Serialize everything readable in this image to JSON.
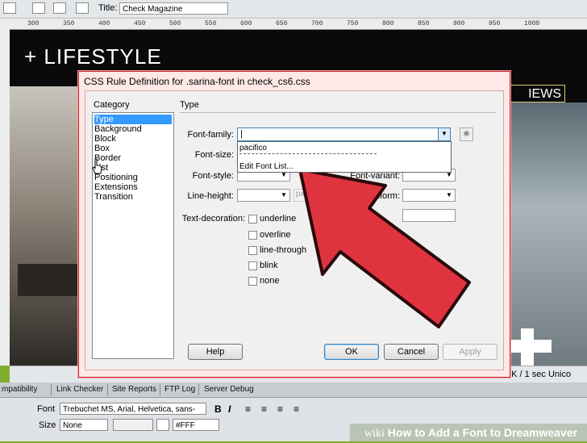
{
  "toolbar": {
    "title_label": "Title:",
    "title_value": "Check Magazine"
  },
  "ruler": {
    "ticks": [
      "300",
      "350",
      "400",
      "450",
      "500",
      "550",
      "600",
      "650",
      "700",
      "750",
      "800",
      "850",
      "900",
      "950",
      "1000"
    ]
  },
  "preview": {
    "heading": "+ LIFESTYLE",
    "news_tab": "IEWS"
  },
  "status": {
    "text": "1K / 1 sec  Unico"
  },
  "properties": {
    "tabs": [
      "mpatibility",
      "Link Checker",
      "Site Reports",
      "FTP Log",
      "Server Debug"
    ],
    "font_label": "Font",
    "font_value": "Trebuchet MS, Arial, Helvetica, sans-",
    "size_label": "Size",
    "size_value": "None",
    "color_value": "#FFF",
    "bold_label": "B",
    "italic_label": "I"
  },
  "watermark": {
    "brand": "wiki",
    "text": "How to Add a Font to Dreamweaver"
  },
  "dialog": {
    "title": "CSS Rule Definition for .sarina-font in check_cs6.css",
    "category_label": "Category",
    "categories": [
      "Type",
      "Background",
      "Block",
      "Box",
      "Border",
      "List",
      "Positioning",
      "Extensions",
      "Transition"
    ],
    "selected_category": "Type",
    "section_title": "Type",
    "fields": {
      "font_family_label": "Font-family:",
      "font_family_value": "|",
      "font_size_label": "Font-size:",
      "font_style_label": "Font-style:",
      "line_height_label": "Line-height:",
      "line_height_unit": "px",
      "font_variant_label": "Font-variant:",
      "text_transform_label": "ansform:",
      "text_decoration_label": "Text-decoration:"
    },
    "dropdown_options": [
      "pacifico",
      "Edit Font List..."
    ],
    "decorations": [
      "underline",
      "overline",
      "line-through",
      "blink",
      "none"
    ],
    "buttons": {
      "help": "Help",
      "ok": "OK",
      "cancel": "Cancel",
      "apply": "Apply"
    }
  },
  "colors": {
    "frame_green": "#7fae2c",
    "dialog_border": "#cc2233",
    "arrow_red": "#e03340",
    "selection_blue": "#3399ff"
  }
}
